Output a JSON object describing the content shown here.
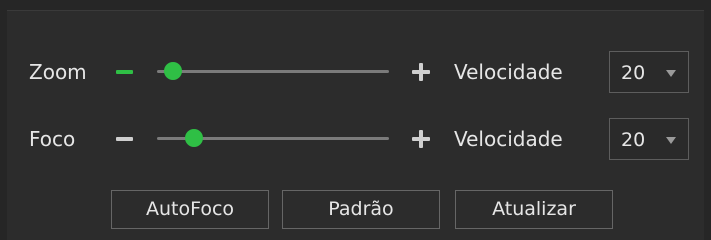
{
  "colors": {
    "accent": "#2fbf45",
    "track": "#7b7b7b",
    "background": "#262626",
    "panel": "#2c2c2c",
    "text": "#e6e6e6",
    "minus_inactive": "#cfcfcf"
  },
  "zoom": {
    "label": "Zoom",
    "minus_icon": "minus-icon",
    "plus_icon": "plus-icon",
    "slider_value": 0.07,
    "speed_label": "Velocidade",
    "speed_value": "20"
  },
  "focus": {
    "label": "Foco",
    "minus_icon": "minus-icon",
    "plus_icon": "plus-icon",
    "slider_value": 0.16,
    "speed_label": "Velocidade",
    "speed_value": "20"
  },
  "buttons": {
    "autofocus": "AutoFoco",
    "default": "Padrão",
    "refresh": "Atualizar"
  }
}
